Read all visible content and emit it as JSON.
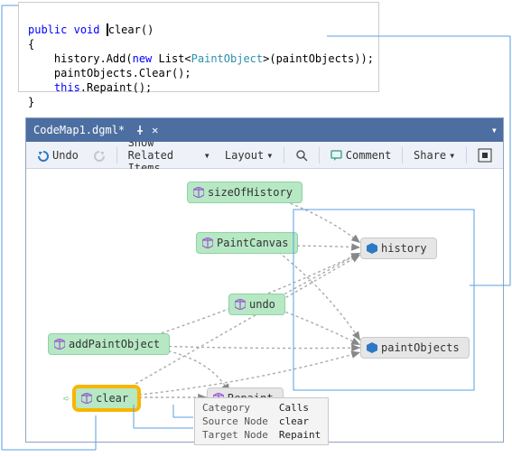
{
  "code": {
    "access": "public",
    "ret": "void",
    "method": "clear",
    "parens": "()",
    "brace_open": "{",
    "line1_a": "    history.Add(",
    "line1_new": "new",
    "line1_list": " List",
    "line1_po": "<",
    "line1_type": "PaintObject",
    "line1_b": ">(paintObjects));",
    "line2": "    paintObjects.Clear();",
    "line3_this": "    this",
    "line3_rest": ".Repaint();",
    "brace_close": "}"
  },
  "titlebar": {
    "title": "CodeMap1.dgml*"
  },
  "toolbar": {
    "undo": "Undo",
    "showrelated": "Show Related Items",
    "layout": "Layout",
    "comment": "Comment",
    "share": "Share"
  },
  "nodes": {
    "sizeOfHistory": "sizeOfHistory",
    "paintCanvas": "PaintCanvas",
    "addPaintObject": "addPaintObject",
    "undo": "undo",
    "clear": "clear",
    "repaint": "Repaint",
    "history": "history",
    "paintObjects": "paintObjects"
  },
  "tooltip": {
    "k1": "Category",
    "v1": "Calls",
    "k2": "Source Node",
    "v2": "clear",
    "k3": "Target Node",
    "v3": "Repaint"
  },
  "icons": {
    "purpleCube": "#9b59d0",
    "blueCube": "#2c78c4"
  }
}
